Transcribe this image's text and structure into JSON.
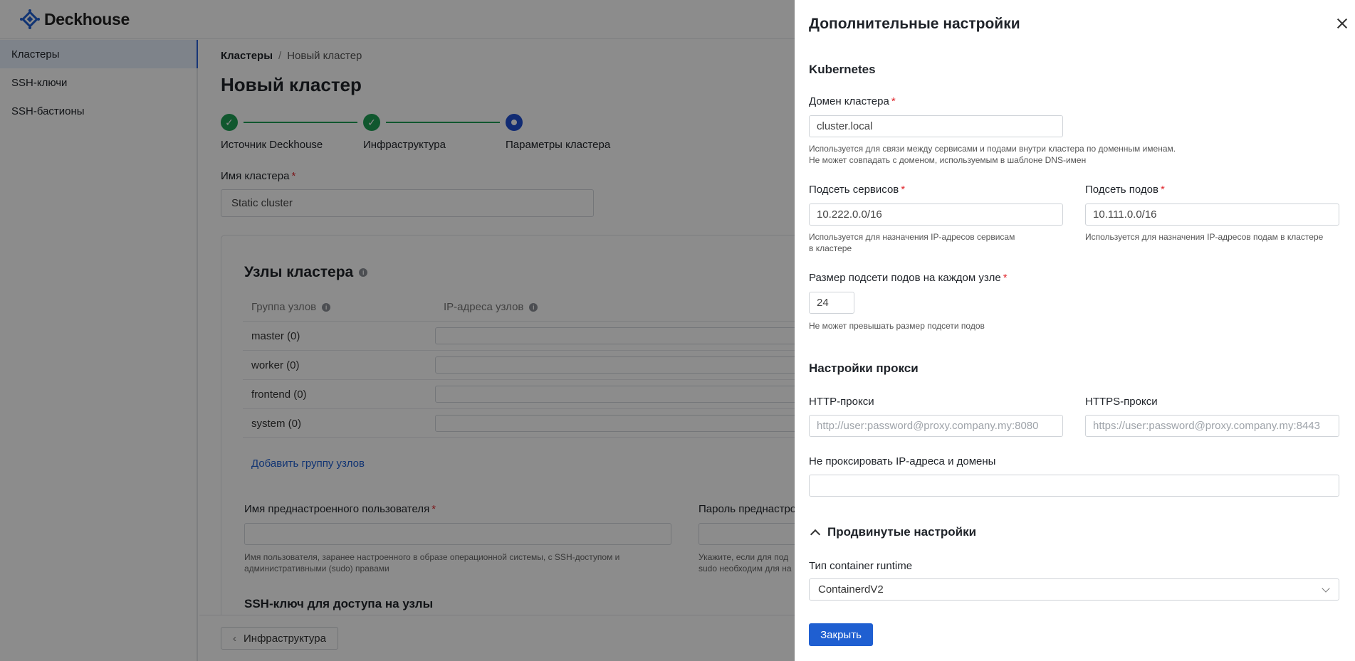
{
  "app": {
    "name": "Deckhouse"
  },
  "sidebar": {
    "items": [
      {
        "label": "Кластеры"
      },
      {
        "label": "SSH-ключи"
      },
      {
        "label": "SSH-бастионы"
      }
    ]
  },
  "breadcrumb": {
    "root": "Кластеры",
    "separator": "/",
    "current": "Новый кластер"
  },
  "page": {
    "title": "Новый кластер"
  },
  "stepper": {
    "steps": [
      {
        "label": "Источник Deckhouse",
        "status": "done"
      },
      {
        "label": "Инфраструктура",
        "status": "done"
      },
      {
        "label": "Параметры кластера",
        "status": "current"
      }
    ]
  },
  "cluster_name": {
    "label": "Имя кластера",
    "required": "*",
    "value": "Static cluster"
  },
  "nodes_card": {
    "title": "Узлы кластера",
    "col_group": "Группа узлов",
    "col_ips": "IP-адреса узлов",
    "groups": [
      {
        "name": "master (0)"
      },
      {
        "name": "worker (0)"
      },
      {
        "name": "frontend (0)"
      },
      {
        "name": "system (0)"
      }
    ],
    "add_group": "Добавить группу узлов",
    "user_label": "Имя преднастроенного пользователя",
    "user_hint_1": "Имя пользователя, заранее настроенного в образе операционной системы, с SSH-доступом и",
    "user_hint_2": "административными (sudo) правами",
    "password_label": "Пароль преднастро",
    "password_hint_1": "Укажите, если для под",
    "password_hint_2": "sudo необходим для на",
    "ssh_title": "SSH-ключ для доступа на узлы"
  },
  "footer": {
    "back_label": "Инфраструктура"
  },
  "drawer": {
    "title": "Дополнительные настройки",
    "kubernetes_title": "Kubernetes",
    "domain": {
      "label": "Домен кластера",
      "required": "*",
      "value": "cluster.local",
      "hint_1": "Используется для связи между сервисами и подами внутри кластера по доменным именам.",
      "hint_2": "Не может совпадать с доменом, используемым в шаблоне DNS-имен"
    },
    "service_subnet": {
      "label": "Подсеть сервисов",
      "required": "*",
      "value": "10.222.0.0/16",
      "hint_1": "Используется для назначения IP-адресов сервисам",
      "hint_2": "в кластере"
    },
    "pod_subnet": {
      "label": "Подсеть подов",
      "required": "*",
      "value": "10.111.0.0/16",
      "hint": "Используется для назначения IP-адресов подам в кластере"
    },
    "node_subnet_size": {
      "label": "Размер подсети подов на каждом узле",
      "required": "*",
      "value": "24",
      "hint": "Не может превышать размер подсети подов"
    },
    "proxy_title": "Настройки прокси",
    "http_proxy": {
      "label": "HTTP-прокси",
      "placeholder": "http://user:password@proxy.company.my:8080"
    },
    "https_proxy": {
      "label": "HTTPS-прокси",
      "placeholder": "https://user:password@proxy.company.my:8443"
    },
    "no_proxy": {
      "label": "Не проксировать IP-адреса и домены",
      "value": ""
    },
    "advanced_title": "Продвинутые настройки",
    "runtime": {
      "label": "Тип container runtime",
      "value": "ContainerdV2"
    },
    "close_button": "Закрыть"
  },
  "colors": {
    "accent": "#1f5fd1",
    "success": "#1e9e55",
    "required": "#e0282e"
  }
}
